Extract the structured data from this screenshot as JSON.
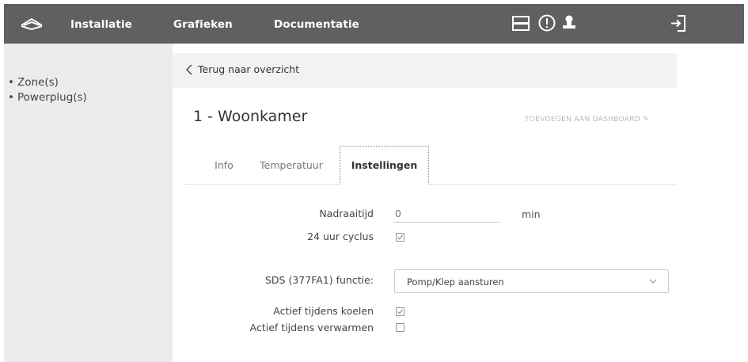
{
  "header": {
    "nav": [
      "Installatie",
      "Grafieken",
      "Documentatie"
    ],
    "icons": [
      "logo-icon",
      "menu-icon",
      "alert-icon",
      "user-icon",
      "logout-icon"
    ]
  },
  "sidebar": {
    "items": [
      {
        "label": "Zone(s)"
      },
      {
        "label": "Powerplug(s)"
      }
    ]
  },
  "main": {
    "back_label": "Terug naar overzicht",
    "title": "1 - Woonkamer",
    "dashboard_link": "TOEVOEGEN AAN DASHBOARD",
    "tabs": [
      "Info",
      "Temperatuur",
      "Instellingen"
    ],
    "active_tab": "Instellingen"
  },
  "settings": {
    "nadraaitijd": {
      "label": "Nadraaitijd",
      "value": "0",
      "unit": "min"
    },
    "cyclus": {
      "label": "24 uur cyclus",
      "checked": true
    },
    "sds": {
      "label": "SDS (377FA1) functie:",
      "value": "Pomp/Klep aansturen"
    },
    "koelen": {
      "label": "Actief tijdens koelen",
      "checked": true
    },
    "verwarmen": {
      "label": "Actief tijdens verwarmen",
      "checked": false
    }
  },
  "colors": {
    "topbar": "#606060",
    "sidebar": "#ececec",
    "backbar": "#f2f2f2"
  }
}
